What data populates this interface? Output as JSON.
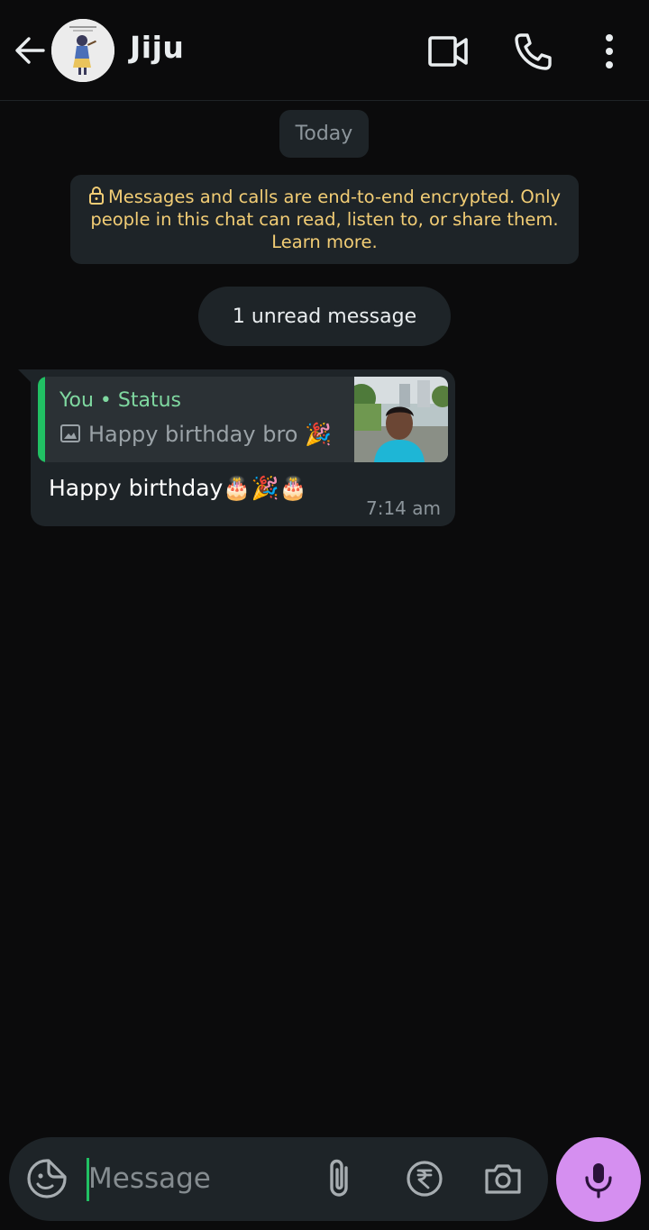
{
  "header": {
    "contact_name": "Jiju",
    "icons": [
      "back-arrow-icon",
      "avatar",
      "video-call-icon",
      "voice-call-icon",
      "more-options-icon"
    ]
  },
  "chat": {
    "date_chip": "Today",
    "encryption_notice": "Messages and calls are end-to-end encrypted. Only people in this chat can read, listen to, or share them. Learn more.",
    "unread_label": "1 unread message",
    "messages": [
      {
        "reply": {
          "author": "You • Status",
          "text": "Happy birthday bro 🎉"
        },
        "text": "Happy birthday🎂🎉🎂",
        "time": "7:14 am"
      }
    ]
  },
  "composer": {
    "placeholder": "Message",
    "icons": [
      "sticker-icon",
      "attach-icon",
      "rupee-payment-icon",
      "camera-icon",
      "mic-icon"
    ]
  },
  "colors": {
    "background": "#0b0b0c",
    "bubble": "#1e2428",
    "accent_green": "#21c063",
    "notice_text": "#f2cd75",
    "mic_button": "#d58ff0"
  }
}
